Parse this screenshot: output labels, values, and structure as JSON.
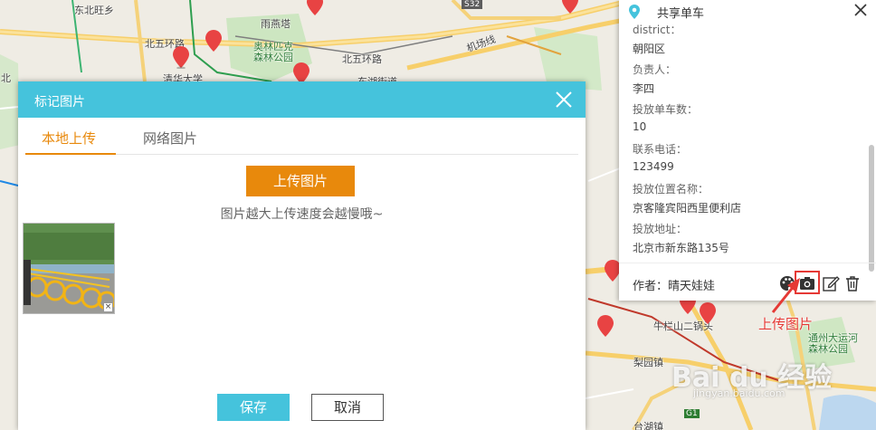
{
  "map": {
    "labels": {
      "dongbei": "东北旺乡",
      "yanqi": "雨燕塔",
      "beiwuhuan_left": "北五环路",
      "beiwuhuan_right": "北五环路",
      "olympic": "奥林匹克",
      "olympic2": "森林公园",
      "tsinghua": "清华大学",
      "jichang": "机场线",
      "s32": "S32",
      "dongbeijie": "东湖街道",
      "niulan": "牛栏山二锅头",
      "tongzhou": "通州大运河",
      "tongzhou2": "森林公园",
      "liyuan": "梨园镇",
      "g1": "G1",
      "taihu": "台湖镇",
      "bei": "北"
    }
  },
  "dialog": {
    "title": "标记图片",
    "tabs": [
      "本地上传",
      "网络图片"
    ],
    "upload_label": "上传图片",
    "hint": "图片越大上传速度会越慢哦~",
    "thumb_delete": "×",
    "save_label": "保存",
    "cancel_label": "取消"
  },
  "panel": {
    "title": "共享单车",
    "fields": [
      {
        "label": "district：",
        "value": "朝阳区"
      },
      {
        "label": "负责人：",
        "value": "李四"
      },
      {
        "label": "投放单车数：",
        "value": "10"
      },
      {
        "label": "联系电话：",
        "value": "123499"
      },
      {
        "label": "投放位置名称：",
        "value": "京客隆宾阳西里便利店"
      },
      {
        "label": "投放地址：",
        "value": "北京市新东路135号"
      }
    ],
    "author": "作者：晴天娃娃"
  },
  "annotation": "上传图片",
  "watermark": {
    "main": "Bai du 经验",
    "sub": "jingyan.baidu.com"
  },
  "colors": {
    "accent_blue": "#45c3dc",
    "accent_orange": "#e8890c",
    "annotation_red": "#e53935"
  },
  "icons": [
    "location-pin-icon",
    "close-icon",
    "palette-icon",
    "camera-icon",
    "edit-icon",
    "trash-icon",
    "map-marker-icon"
  ]
}
